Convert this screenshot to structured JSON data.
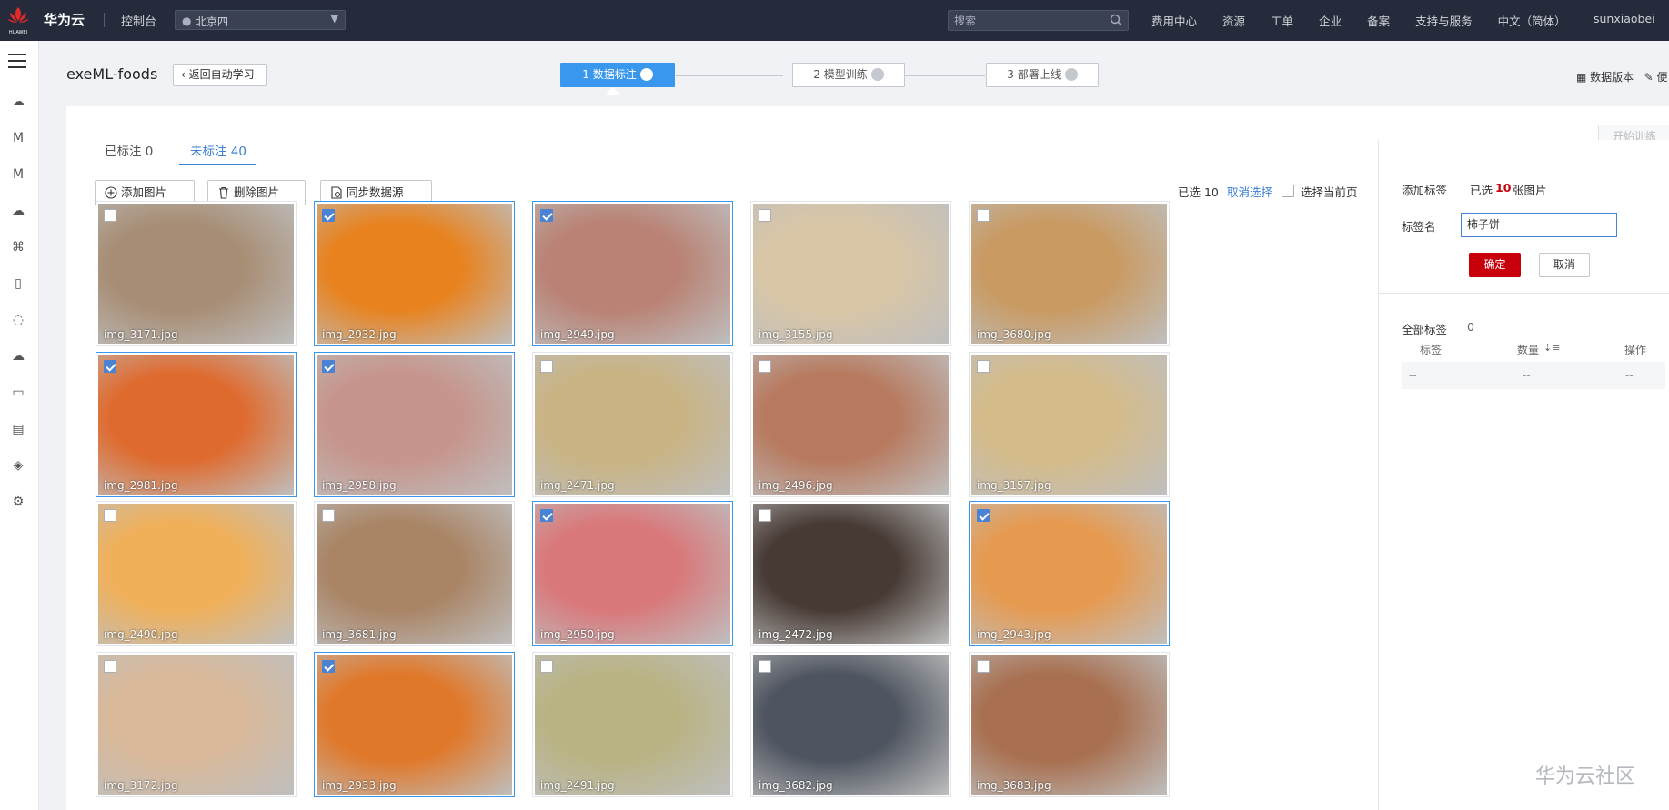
{
  "topbar": {
    "brand": "华为云",
    "logo_text": "HUAWEI",
    "console": "控制台",
    "region": "北京四",
    "search_placeholder": "搜索",
    "nav": [
      "费用中心",
      "资源",
      "工单",
      "企业",
      "备案",
      "支持与服务",
      "中文（简体）"
    ],
    "user": "sunxiaobei"
  },
  "header": {
    "title": "exeML-foods",
    "back": "返回自动学习",
    "steps": [
      "1 数据标注",
      "2 模型训练",
      "3 部署上线"
    ],
    "right_links": "数据版本",
    "right_link2": "便"
  },
  "panel": {
    "tab_labeled": "已标注 0",
    "tab_unlabeled": "未标注 40",
    "start_train": "开始训练",
    "toolbar": {
      "add": "添加图片",
      "delete": "删除图片",
      "sync": "同步数据源"
    },
    "selection": {
      "selected": "已选 10",
      "cancel": "取消选择",
      "select_page": "选择当前页"
    }
  },
  "images": [
    {
      "name": "img_3171.jpg",
      "checked": false,
      "color": "#a78d74"
    },
    {
      "name": "img_2932.jpg",
      "checked": true,
      "color": "#e8821e"
    },
    {
      "name": "img_2949.jpg",
      "checked": true,
      "color": "#b98274"
    },
    {
      "name": "img_3155.jpg",
      "checked": false,
      "color": "#d9c6a6"
    },
    {
      "name": "img_3680.jpg",
      "checked": false,
      "color": "#c99a62"
    },
    {
      "name": "img_2981.jpg",
      "checked": true,
      "color": "#df6a2e"
    },
    {
      "name": "img_2958.jpg",
      "checked": true,
      "color": "#c6958c"
    },
    {
      "name": "img_2471.jpg",
      "checked": false,
      "color": "#c9b382"
    },
    {
      "name": "img_2496.jpg",
      "checked": false,
      "color": "#b77a5f"
    },
    {
      "name": "img_3157.jpg",
      "checked": false,
      "color": "#d4bb8a"
    },
    {
      "name": "img_2490.jpg",
      "checked": false,
      "color": "#f0b05a"
    },
    {
      "name": "img_3681.jpg",
      "checked": false,
      "color": "#a98465"
    },
    {
      "name": "img_2950.jpg",
      "checked": true,
      "color": "#d9787a"
    },
    {
      "name": "img_2472.jpg",
      "checked": false,
      "color": "#473a34"
    },
    {
      "name": "img_2943.jpg",
      "checked": true,
      "color": "#e69a50"
    },
    {
      "name": "img_3172.jpg",
      "checked": false,
      "color": "#d9b99a"
    },
    {
      "name": "img_2933.jpg",
      "checked": true,
      "color": "#e0782a"
    },
    {
      "name": "img_2491.jpg",
      "checked": false,
      "color": "#b9b384"
    },
    {
      "name": "img_3682.jpg",
      "checked": false,
      "color": "#4f5560"
    },
    {
      "name": "img_3683.jpg",
      "checked": false,
      "color": "#a87050"
    }
  ],
  "right": {
    "add_label": "添加标签",
    "selected_prefix": "已选",
    "selected_count": "10",
    "selected_suffix": "张图片",
    "label_name": "标签名",
    "label_value": "柿子饼",
    "ok": "确定",
    "cancel": "取消",
    "all_labels": "全部标签",
    "all_labels_count": "0",
    "col_tag": "标签",
    "col_count": "数量",
    "col_ops": "操作",
    "empty": "--"
  },
  "watermark": "华为云社区",
  "colors": {
    "topbar": "#252b3a",
    "accent": "#3a97ee",
    "danger": "#c7000b"
  }
}
